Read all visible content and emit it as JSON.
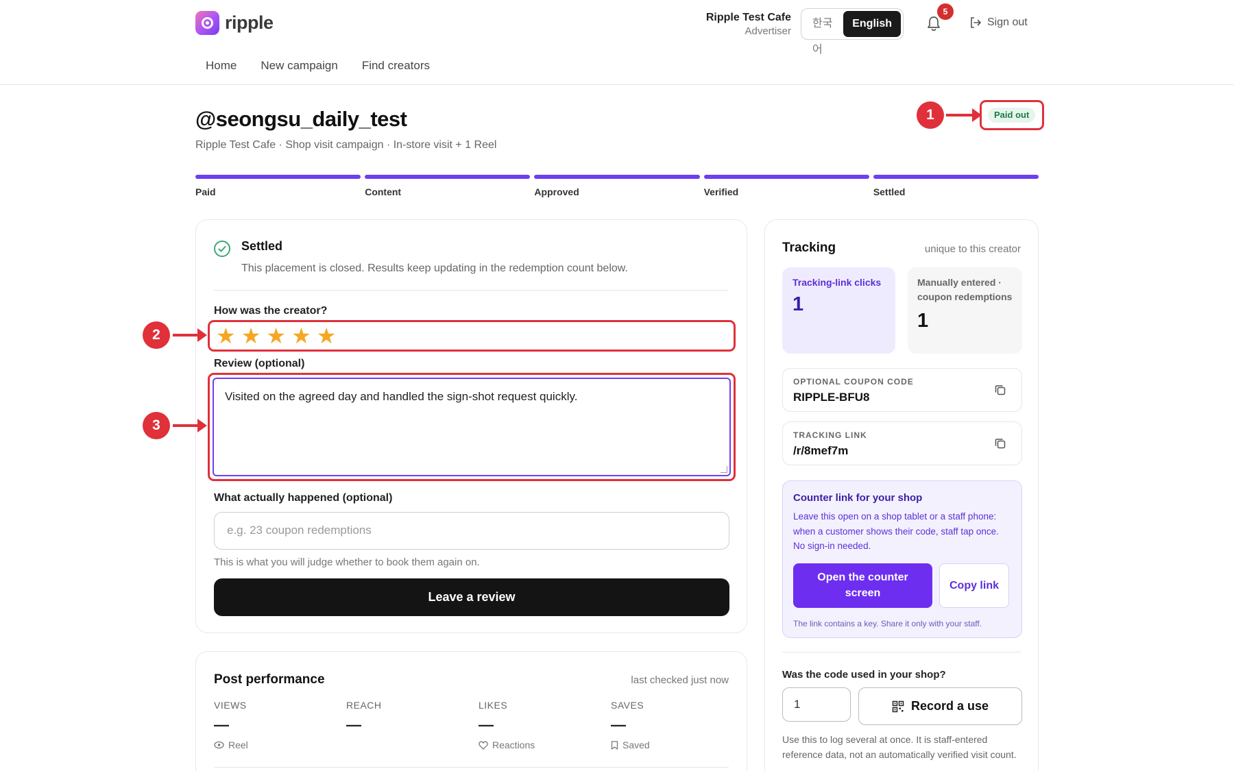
{
  "header": {
    "brand": "ripple",
    "account_name": "Ripple Test Cafe",
    "account_role": "Advertiser",
    "languages": [
      "한국어",
      "English"
    ],
    "active_language": "English",
    "notification_count": "5",
    "signout_label": "Sign out",
    "nav": [
      "Home",
      "New campaign",
      "Find creators"
    ]
  },
  "page": {
    "title": "@seongsu_daily_test",
    "subtitle": "Ripple Test Cafe · Shop visit campaign · In-store visit + 1 Reel",
    "status": "Paid out"
  },
  "progress": {
    "steps": [
      "Paid",
      "Content",
      "Approved",
      "Verified",
      "Settled"
    ]
  },
  "settled": {
    "title": "Settled",
    "description": "This placement is closed. Results keep updating in the redemption count below."
  },
  "review_form": {
    "rating_label": "How was the creator?",
    "rating": 5,
    "rating_max": 5,
    "review_label": "Review (optional)",
    "review_value": "Visited on the agreed day and handled the sign-shot request quickly.",
    "happened_label": "What actually happened (optional)",
    "happened_placeholder": "e.g. 23 coupon redemptions",
    "hint": "This is what you will judge whether to book them again on.",
    "submit_label": "Leave a review"
  },
  "performance": {
    "title": "Post performance",
    "checked": "last checked just now",
    "metrics": [
      {
        "label": "VIEWS",
        "value": "—",
        "note": "Reel"
      },
      {
        "label": "REACH",
        "value": "—",
        "note": ""
      },
      {
        "label": "LIKES",
        "value": "—",
        "note": "Reactions"
      },
      {
        "label": "SAVES",
        "value": "—",
        "note": "Saved"
      }
    ]
  },
  "tracking": {
    "title": "Tracking",
    "subtitle": "unique to this creator",
    "clicks_label": "Tracking-link clicks",
    "clicks_value": "1",
    "manual_label": "Manually entered · coupon redemptions",
    "manual_value": "1",
    "coupon_label": "OPTIONAL COUPON CODE",
    "coupon_value": "RIPPLE-BFU8",
    "link_label": "TRACKING LINK",
    "link_value": "/r/8mef7m",
    "counter_title": "Counter link for your shop",
    "counter_desc": "Leave this open on a shop tablet or a staff phone: when a customer shows their code, staff tap once. No sign-in needed.",
    "open_counter_label": "Open the counter screen",
    "copy_link_label": "Copy link",
    "counter_note": "The link contains a key. Share it only with your staff.",
    "question": "Was the code used in your shop?",
    "quantity_value": "1",
    "record_label": "Record a use",
    "record_note": "Use this to log several at once. It is staff-entered reference data, not an automatically verified visit count."
  },
  "annotations": [
    "1",
    "2",
    "3"
  ],
  "colors": {
    "accent": "#6d3ff0",
    "annotation": "#e0303a",
    "star": "#f5a623",
    "status_green": "#1e7a46"
  }
}
